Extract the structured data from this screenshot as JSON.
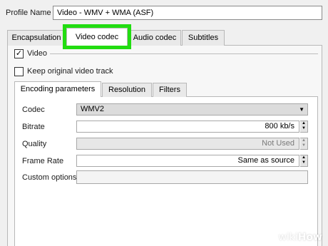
{
  "profile": {
    "label": "Profile Name",
    "value": "Video - WMV + WMA (ASF)"
  },
  "tabs": [
    {
      "label": "Encapsulation"
    },
    {
      "label": "Video codec",
      "selected": true
    },
    {
      "label": "Audio codec"
    },
    {
      "label": "Subtitles"
    }
  ],
  "video": {
    "enabled_label": "Video",
    "enabled_mark": "✓",
    "keep_original_label": "Keep original video track"
  },
  "inner_tabs": [
    {
      "label": "Encoding parameters",
      "selected": true
    },
    {
      "label": "Resolution"
    },
    {
      "label": "Filters"
    }
  ],
  "form": {
    "codec_label": "Codec",
    "codec_value": "WMV2",
    "bitrate_label": "Bitrate",
    "bitrate_value": "800 kb/s",
    "quality_label": "Quality",
    "quality_value": "Not Used",
    "framerate_label": "Frame Rate",
    "framerate_value": "Same as source",
    "custom_label": "Custom options",
    "custom_value": ""
  },
  "highlight_color": "#22dd11",
  "watermark": {
    "wiki": "wiki",
    "how": "How"
  }
}
